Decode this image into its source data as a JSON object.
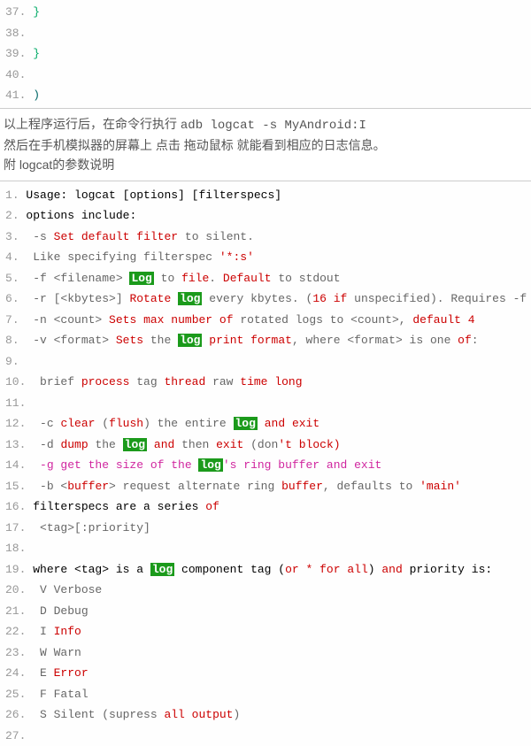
{
  "topcode": {
    "start": 36,
    "lines": [
      [
        {
          "cls": "brace",
          "t": "}"
        }
      ],
      [
        {
          "cls": "black",
          "t": " "
        }
      ],
      [
        {
          "cls": "brace",
          "t": "}"
        }
      ],
      [
        {
          "cls": "black",
          "t": " "
        }
      ],
      [
        {
          "cls": "paren-close",
          "t": ")"
        }
      ]
    ]
  },
  "middle": {
    "line1a": "以上程序运行后，在命令行执行  ",
    "line1b": "adb logcat -s MyAndroid:I",
    "line2": "然后在手机模拟器的屏幕上 点击 拖动鼠标 就能看到相应的日志信息。",
    "line3": "附 logcat的参数说明"
  },
  "help": {
    "start": 0,
    "lines": [
      [
        {
          "cls": "black",
          "t": "Usage: logcat [options] [filterspecs]"
        }
      ],
      [
        {
          "cls": "black",
          "t": "options include:"
        }
      ],
      [
        {
          "cls": "gray",
          "t": " -s "
        },
        {
          "cls": "kw-red",
          "t": "Set"
        },
        {
          "cls": "gray",
          "t": " "
        },
        {
          "cls": "kw-red",
          "t": "default"
        },
        {
          "cls": "gray",
          "t": " "
        },
        {
          "cls": "kw-red",
          "t": "filter"
        },
        {
          "cls": "gray",
          "t": " to silent."
        }
      ],
      [
        {
          "cls": "gray",
          "t": " Like specifying filterspec "
        },
        {
          "cls": "str-red",
          "t": "'*:s'"
        }
      ],
      [
        {
          "cls": "gray",
          "t": " -f <filename> "
        },
        {
          "cls": "highlight-log",
          "t": "Log"
        },
        {
          "cls": "gray",
          "t": " to "
        },
        {
          "cls": "kw-red",
          "t": "file"
        },
        {
          "cls": "gray",
          "t": ". "
        },
        {
          "cls": "kw-red",
          "t": "Default"
        },
        {
          "cls": "gray",
          "t": " to stdout"
        }
      ],
      [
        {
          "cls": "gray",
          "t": " -r [<kbytes>] "
        },
        {
          "cls": "kw-red",
          "t": "Rotate"
        },
        {
          "cls": "gray",
          "t": " "
        },
        {
          "cls": "highlight-log",
          "t": "log"
        },
        {
          "cls": "gray",
          "t": " every kbytes. ("
        },
        {
          "cls": "num",
          "t": "16"
        },
        {
          "cls": "gray",
          "t": " "
        },
        {
          "cls": "kw-red",
          "t": "if"
        },
        {
          "cls": "gray",
          "t": " unspecified). Requires -f"
        }
      ],
      [
        {
          "cls": "gray",
          "t": " -n <count> "
        },
        {
          "cls": "kw-red",
          "t": "Sets"
        },
        {
          "cls": "gray",
          "t": " "
        },
        {
          "cls": "kw-red",
          "t": "max"
        },
        {
          "cls": "gray",
          "t": " "
        },
        {
          "cls": "kw-red",
          "t": "number"
        },
        {
          "cls": "gray",
          "t": " "
        },
        {
          "cls": "kw-red",
          "t": "of"
        },
        {
          "cls": "gray",
          "t": " rotated logs to <count>, "
        },
        {
          "cls": "kw-red",
          "t": "default"
        },
        {
          "cls": "gray",
          "t": " "
        },
        {
          "cls": "num",
          "t": "4"
        }
      ],
      [
        {
          "cls": "gray",
          "t": " -v <format> "
        },
        {
          "cls": "kw-red",
          "t": "Sets"
        },
        {
          "cls": "gray",
          "t": " the "
        },
        {
          "cls": "highlight-log",
          "t": "log"
        },
        {
          "cls": "gray",
          "t": " "
        },
        {
          "cls": "kw-red",
          "t": "print"
        },
        {
          "cls": "gray",
          "t": " "
        },
        {
          "cls": "kw-red",
          "t": "format"
        },
        {
          "cls": "gray",
          "t": ", where <format> is one "
        },
        {
          "cls": "kw-red",
          "t": "of"
        },
        {
          "cls": "gray",
          "t": ":"
        }
      ],
      [
        {
          "cls": "gray",
          "t": " "
        }
      ],
      [
        {
          "cls": "gray",
          "t": " brief "
        },
        {
          "cls": "kw-red",
          "t": "process"
        },
        {
          "cls": "gray",
          "t": " tag "
        },
        {
          "cls": "kw-red",
          "t": "thread"
        },
        {
          "cls": "gray",
          "t": " raw "
        },
        {
          "cls": "kw-red",
          "t": "time"
        },
        {
          "cls": "gray",
          "t": " "
        },
        {
          "cls": "kw-red",
          "t": "long"
        }
      ],
      [
        {
          "cls": "gray",
          "t": " "
        }
      ],
      [
        {
          "cls": "gray",
          "t": " -c "
        },
        {
          "cls": "kw-red",
          "t": "clear"
        },
        {
          "cls": "gray",
          "t": " ("
        },
        {
          "cls": "kw-red",
          "t": "flush"
        },
        {
          "cls": "gray",
          "t": ") the entire "
        },
        {
          "cls": "highlight-log",
          "t": "log"
        },
        {
          "cls": "gray",
          "t": " "
        },
        {
          "cls": "kw-red",
          "t": "and"
        },
        {
          "cls": "gray",
          "t": " "
        },
        {
          "cls": "kw-red",
          "t": "exit"
        }
      ],
      [
        {
          "cls": "gray",
          "t": " -d "
        },
        {
          "cls": "kw-red",
          "t": "dump"
        },
        {
          "cls": "gray",
          "t": " the "
        },
        {
          "cls": "highlight-log",
          "t": "log"
        },
        {
          "cls": "gray",
          "t": " "
        },
        {
          "cls": "kw-red",
          "t": "and"
        },
        {
          "cls": "gray",
          "t": " then "
        },
        {
          "cls": "kw-red",
          "t": "exit"
        },
        {
          "cls": "gray",
          "t": " (don"
        },
        {
          "cls": "str-red",
          "t": "'t block)"
        }
      ],
      [
        {
          "cls": "kw-pink",
          "t": " -g get the size of the "
        },
        {
          "cls": "highlight-log",
          "t": "log"
        },
        {
          "cls": "kw-pink",
          "t": "'"
        },
        {
          "cls": "kw-pink",
          "t": "s ring buffer and exit"
        }
      ],
      [
        {
          "cls": "gray",
          "t": " -b <"
        },
        {
          "cls": "kw-red",
          "t": "buffer"
        },
        {
          "cls": "gray",
          "t": "> request alternate ring "
        },
        {
          "cls": "kw-red",
          "t": "buffer"
        },
        {
          "cls": "gray",
          "t": ", defaults to "
        },
        {
          "cls": "str-red",
          "t": "'main'"
        }
      ],
      [
        {
          "cls": "black",
          "t": "filterspecs are a series "
        },
        {
          "cls": "kw-red",
          "t": "of"
        }
      ],
      [
        {
          "cls": "gray",
          "t": " <tag>[:priority]"
        }
      ],
      [
        {
          "cls": "gray",
          "t": " "
        }
      ],
      [
        {
          "cls": "black",
          "t": "where <tag> is a "
        },
        {
          "cls": "highlight-log",
          "t": "log"
        },
        {
          "cls": "black",
          "t": " component tag ("
        },
        {
          "cls": "kw-red",
          "t": "or"
        },
        {
          "cls": "black",
          "t": " "
        },
        {
          "cls": "kw-red",
          "t": "*"
        },
        {
          "cls": "black",
          "t": " "
        },
        {
          "cls": "kw-red",
          "t": "for"
        },
        {
          "cls": "black",
          "t": " "
        },
        {
          "cls": "kw-red",
          "t": "all"
        },
        {
          "cls": "black",
          "t": ") "
        },
        {
          "cls": "kw-red",
          "t": "and"
        },
        {
          "cls": "black",
          "t": " priority is:"
        }
      ],
      [
        {
          "cls": "gray",
          "t": " V Verbose"
        }
      ],
      [
        {
          "cls": "gray",
          "t": " D Debug"
        }
      ],
      [
        {
          "cls": "gray",
          "t": " I "
        },
        {
          "cls": "kw-red",
          "t": "Info"
        }
      ],
      [
        {
          "cls": "gray",
          "t": " W Warn"
        }
      ],
      [
        {
          "cls": "gray",
          "t": " E "
        },
        {
          "cls": "kw-red",
          "t": "Error"
        }
      ],
      [
        {
          "cls": "gray",
          "t": " F Fatal"
        }
      ],
      [
        {
          "cls": "gray",
          "t": " S Silent (supress "
        },
        {
          "cls": "kw-red",
          "t": "all"
        },
        {
          "cls": "gray",
          "t": " "
        },
        {
          "cls": "kw-red",
          "t": "output"
        },
        {
          "cls": "gray",
          "t": ")"
        }
      ],
      [
        {
          "cls": "gray",
          "t": " "
        }
      ]
    ]
  }
}
